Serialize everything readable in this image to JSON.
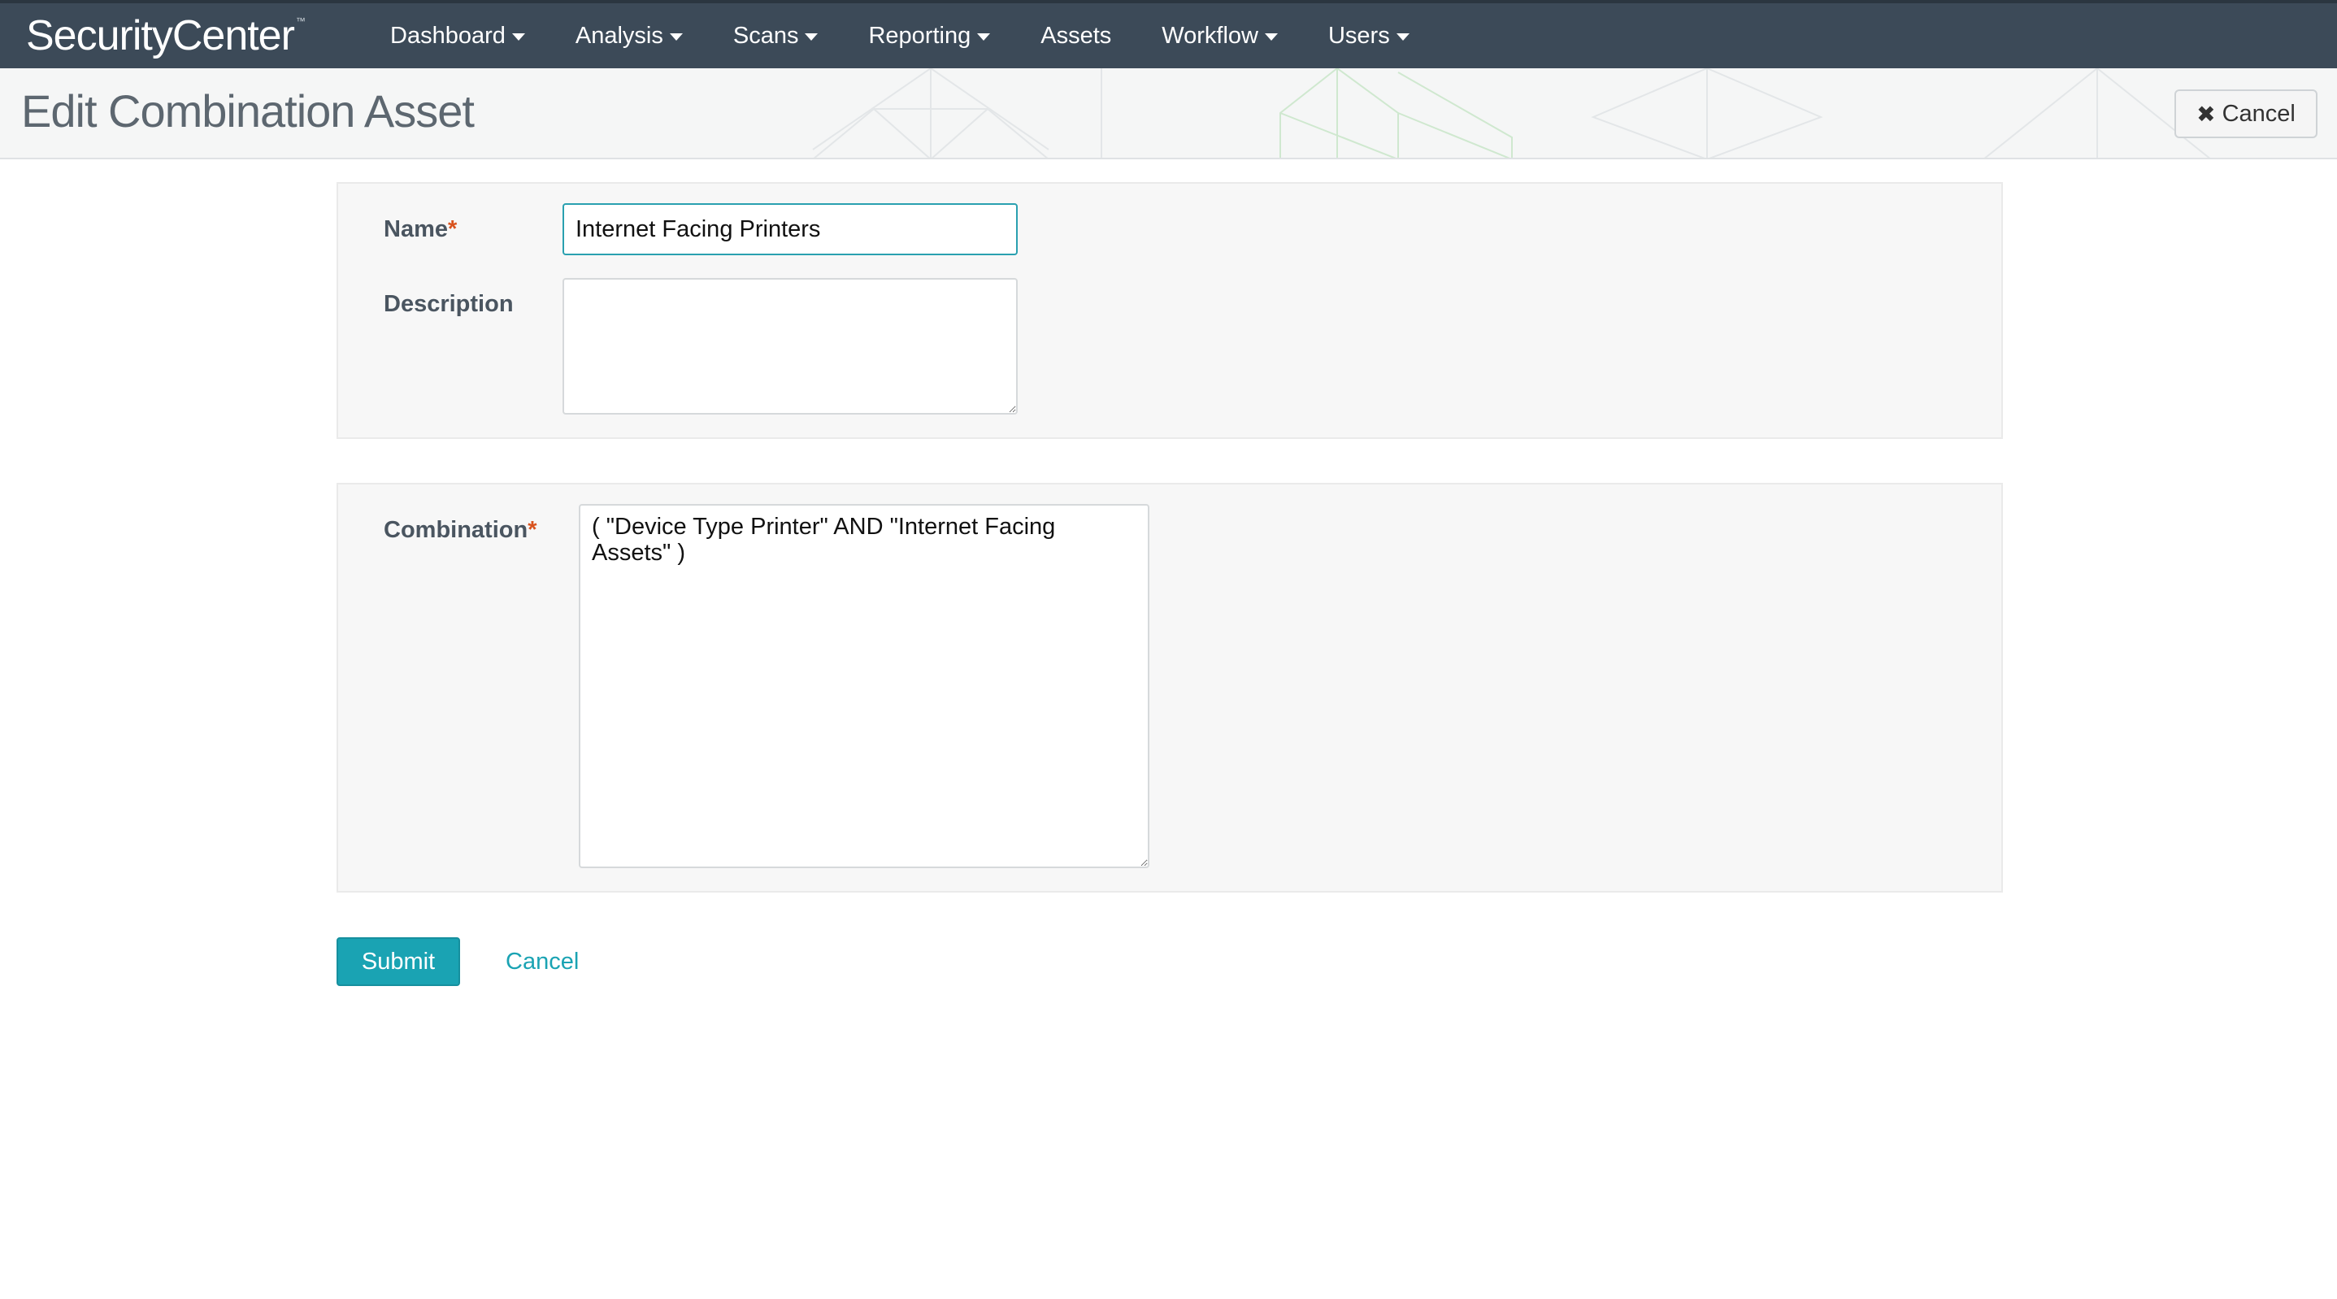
{
  "header": {
    "brand": "SecurityCenter",
    "brand_mark": "™",
    "nav": [
      {
        "label": "Dashboard",
        "has_menu": true
      },
      {
        "label": "Analysis",
        "has_menu": true
      },
      {
        "label": "Scans",
        "has_menu": true
      },
      {
        "label": "Reporting",
        "has_menu": true
      },
      {
        "label": "Assets",
        "has_menu": false
      },
      {
        "label": "Workflow",
        "has_menu": true
      },
      {
        "label": "Users",
        "has_menu": true
      }
    ]
  },
  "titlebar": {
    "title": "Edit Combination Asset",
    "cancel_label": "Cancel",
    "cancel_icon": "close-icon"
  },
  "form": {
    "name_label": "Name",
    "name_value": "Internet Facing Printers",
    "description_label": "Description",
    "description_value": "",
    "combination_label": "Combination",
    "combination_value": "( \"Device Type Printer\" AND \"Internet Facing Assets\" )",
    "required_marker": "*"
  },
  "actions": {
    "submit_label": "Submit",
    "cancel_label": "Cancel"
  },
  "colors": {
    "topbar": "#3c4a58",
    "accent": "#1aa3b3",
    "required": "#d9531e"
  }
}
